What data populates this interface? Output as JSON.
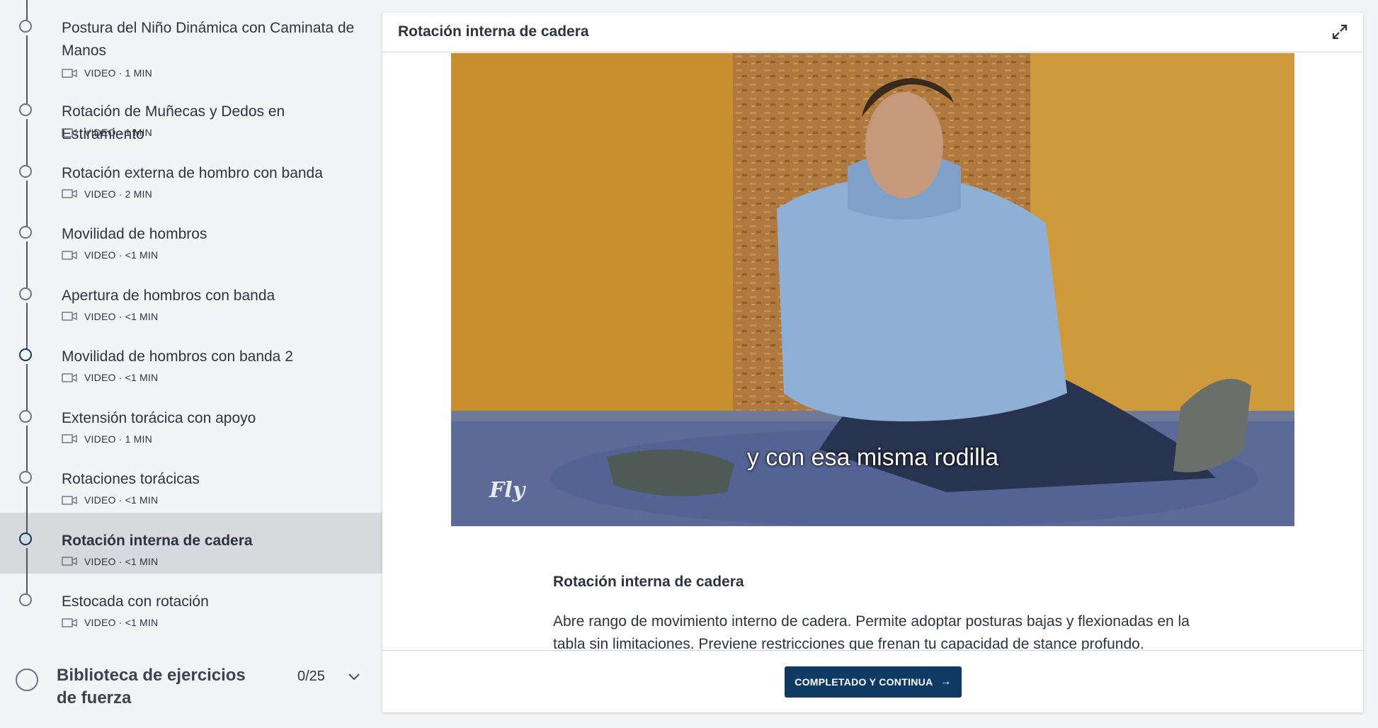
{
  "sidebar": {
    "lessons": [
      {
        "title": "Postura del Niño Dinámica con Caminata de Manos",
        "meta": "VIDEO · 1 MIN"
      },
      {
        "title": "Rotación de Muñecas y Dedos en Estiramiento",
        "meta": "VIDEO · 1 MIN"
      },
      {
        "title": "Rotación externa de hombro con banda",
        "meta": "VIDEO · 2 MIN"
      },
      {
        "title": "Movilidad de hombros",
        "meta": "VIDEO · <1 MIN"
      },
      {
        "title": "Apertura de hombros con banda",
        "meta": "VIDEO · <1 MIN"
      },
      {
        "title": "Movilidad de hombros con banda 2",
        "meta": "VIDEO · <1 MIN"
      },
      {
        "title": "Extensión torácica con apoyo",
        "meta": "VIDEO · 1 MIN"
      },
      {
        "title": "Rotaciones torácicas",
        "meta": "VIDEO · <1 MIN"
      },
      {
        "title": "Rotación interna de cadera",
        "meta": "VIDEO · <1 MIN"
      },
      {
        "title": "Estocada con rotación",
        "meta": "VIDEO · <1 MIN"
      }
    ],
    "chapter": {
      "title": "Biblioteca de ejercicios de fuerza",
      "count": "0/25"
    }
  },
  "panel": {
    "title": "Rotación interna de cadera",
    "video": {
      "subtitle": "y con esa misma rodilla",
      "logo": "Fly"
    },
    "content_title": "Rotación interna de cadera",
    "content_body": "Abre rango de movimiento interno de cadera. Permite adoptar posturas bajas y flexionadas en la tabla sin limitaciones. Previene restricciones que frenan tu capacidad de stance profundo.",
    "complete_button": "COMPLETADO Y CONTINUA"
  },
  "colors": {
    "accent": "#0f3a63",
    "active_row": "#d7d9dd",
    "sidebar_bg": "#f3f4f6"
  },
  "icons": {
    "lesson_type": "video-camera-icon",
    "expand": "expand-icon",
    "chapter_toggle": "chevron-down-icon",
    "button_arrow": "arrow-right-icon"
  }
}
